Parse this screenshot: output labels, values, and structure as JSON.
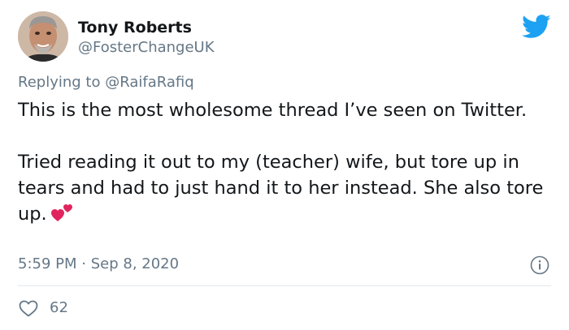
{
  "author": {
    "name": "Tony Roberts",
    "handle": "@FosterChangeUK",
    "avatar_icon": "profile-photo"
  },
  "brand": {
    "icon": "twitter-bird-icon",
    "color": "#1da1f2"
  },
  "reply": {
    "prefix": "Replying to",
    "mention": "@RaifaRafiq"
  },
  "body": {
    "paragraph_1": "This is the most wholesome thread I’ve seen on Twitter.",
    "paragraph_2": "Tried reading it out to my (teacher) wife, but tore up in tears and had to just hand it to her instead. She also tore up.",
    "emoji": "two-hearts"
  },
  "meta": {
    "time": "5:59 PM",
    "separator": "·",
    "date": "Sep 8, 2020",
    "info_icon": "info-icon"
  },
  "actions": {
    "like_icon": "heart-outline-icon",
    "like_count": "62"
  },
  "colors": {
    "text": "#14171a",
    "secondary": "#657786",
    "divider": "#e1e8ed",
    "emoji_red": "#e0245e"
  }
}
